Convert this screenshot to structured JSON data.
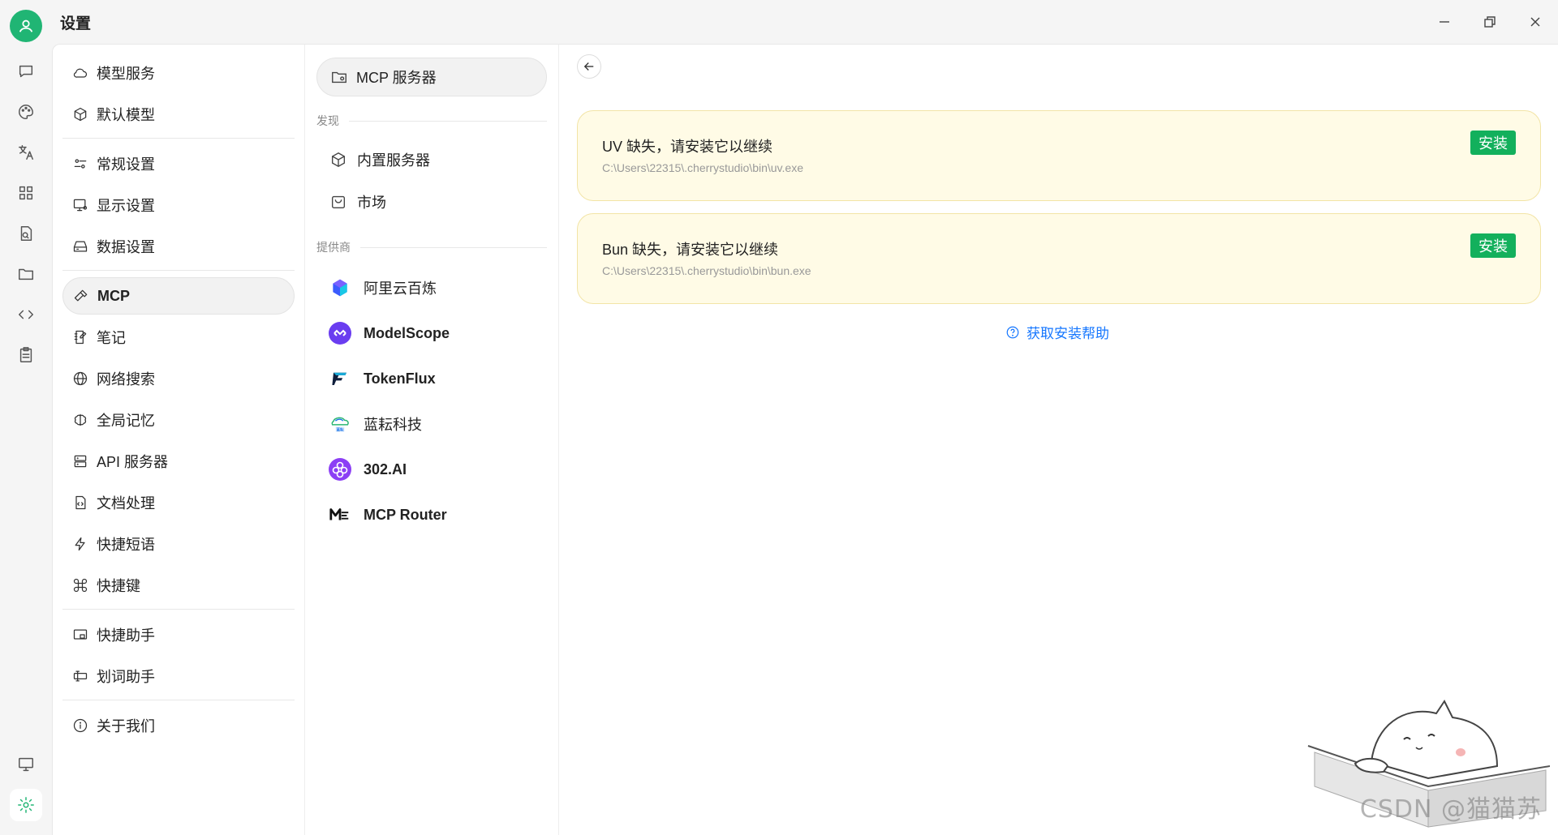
{
  "window": {
    "title": "设置"
  },
  "settings_nav": {
    "items": [
      {
        "label": "模型服务",
        "icon": "cloud-icon"
      },
      {
        "label": "默认模型",
        "icon": "cube-icon"
      },
      {
        "label": "常规设置",
        "icon": "sliders-icon"
      },
      {
        "label": "显示设置",
        "icon": "monitor-icon"
      },
      {
        "label": "数据设置",
        "icon": "drive-icon"
      },
      {
        "label": "MCP",
        "icon": "hammer-icon"
      },
      {
        "label": "笔记",
        "icon": "note-icon"
      },
      {
        "label": "网络搜索",
        "icon": "globe-icon"
      },
      {
        "label": "全局记忆",
        "icon": "brain-icon"
      },
      {
        "label": "API 服务器",
        "icon": "server-icon"
      },
      {
        "label": "文档处理",
        "icon": "file-code-icon"
      },
      {
        "label": "快捷短语",
        "icon": "zap-icon"
      },
      {
        "label": "快捷键",
        "icon": "command-icon"
      },
      {
        "label": "快捷助手",
        "icon": "window-icon"
      },
      {
        "label": "划词助手",
        "icon": "text-cursor-icon"
      },
      {
        "label": "关于我们",
        "icon": "info-icon"
      }
    ],
    "active": "MCP"
  },
  "mcp_nav": {
    "top_label": "MCP 服务器",
    "discover_label": "发现",
    "discover_items": [
      {
        "label": "内置服务器",
        "icon": "cube-icon"
      },
      {
        "label": "市场",
        "icon": "shopping-bag-icon"
      }
    ],
    "providers_label": "提供商",
    "providers": [
      {
        "label": "阿里云百炼",
        "icon": "bailian-logo-icon"
      },
      {
        "label": "ModelScope",
        "icon": "modelscope-logo-icon"
      },
      {
        "label": "TokenFlux",
        "icon": "tokenflux-logo-icon"
      },
      {
        "label": "蓝耘科技",
        "icon": "lanyun-logo-icon"
      },
      {
        "label": "302.AI",
        "icon": "302ai-logo-icon"
      },
      {
        "label": "MCP Router",
        "icon": "mcprouter-logo-icon"
      }
    ]
  },
  "content": {
    "warnings": [
      {
        "title": "UV 缺失，请安装它以继续",
        "path": "C:\\Users\\22315\\.cherrystudio\\bin\\uv.exe",
        "button": "安装"
      },
      {
        "title": "Bun 缺失，请安装它以继续",
        "path": "C:\\Users\\22315\\.cherrystudio\\bin\\bun.exe",
        "button": "安装"
      }
    ],
    "help_link": "获取安装帮助"
  },
  "watermark": "CSDN @猫猫苏",
  "colors": {
    "accent": "#20b574",
    "install": "#13b05c",
    "link": "#1677ff",
    "warning_bg": "#fffbe6"
  }
}
